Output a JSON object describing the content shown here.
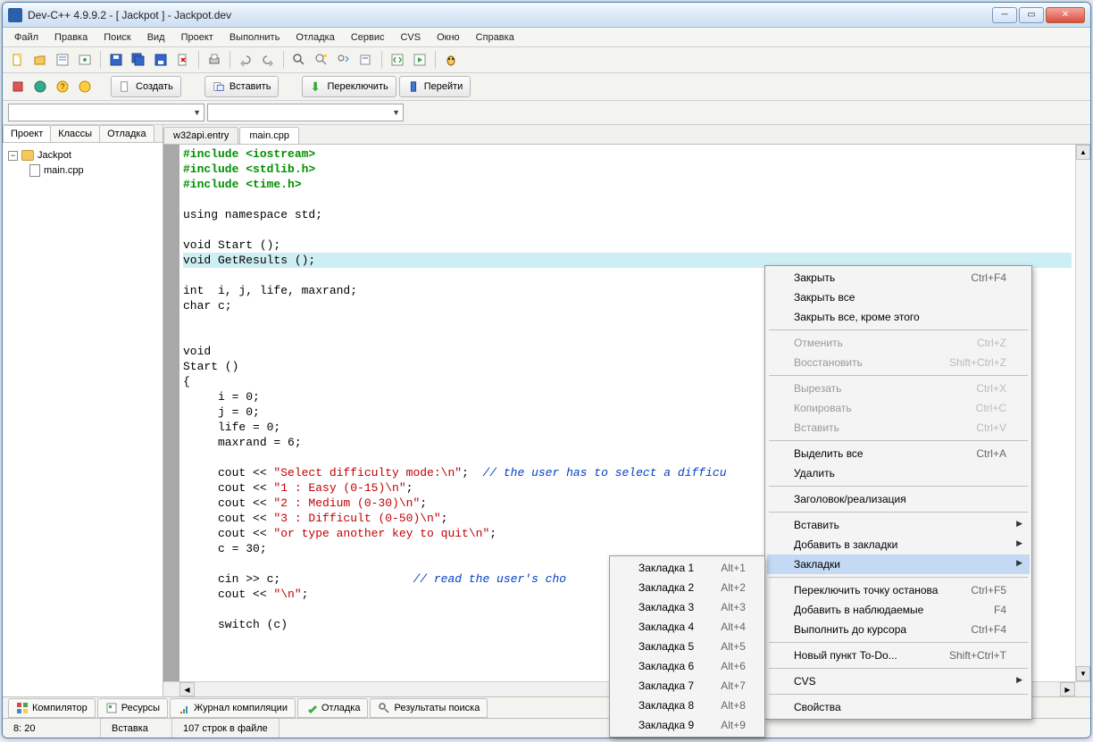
{
  "title": "Dev-C++ 4.9.9.2  -  [ Jackpot ]  -  Jackpot.dev",
  "menu": [
    "Файл",
    "Правка",
    "Поиск",
    "Вид",
    "Проект",
    "Выполнить",
    "Отладка",
    "Сервис",
    "CVS",
    "Окно",
    "Справка"
  ],
  "toolbar2": {
    "create": "Создать",
    "insert": "Вставить",
    "toggle": "Переключить",
    "goto": "Перейти"
  },
  "leftTabs": [
    "Проект",
    "Классы",
    "Отладка"
  ],
  "project": {
    "name": "Jackpot",
    "file": "main.cpp"
  },
  "editorTabs": [
    "w32api.entry",
    "main.cpp"
  ],
  "code": {
    "l1": "#include <iostream>",
    "l2": "#include <stdlib.h>",
    "l3": "#include <time.h>",
    "l5": "using namespace std;",
    "l7": "void Start ();",
    "l8": "void GetResults ();",
    "l10": "int  i, j, life, maxrand;",
    "l11": "char c;",
    "l14": "void",
    "l15": "Start ()",
    "l16": "{",
    "l17": "     i = 0;",
    "l18": "     j = 0;",
    "l19": "     life = 0;",
    "l20": "     maxrand = 6;",
    "l22a": "     cout << ",
    "l22s": "\"Select difficulty mode:\\n\"",
    "l22b": ";  ",
    "l22c": "// the user has to select a difficu",
    "l23a": "     cout << ",
    "l23s": "\"1 : Easy (0-15)\\n\"",
    "l23b": ";",
    "l24a": "     cout << ",
    "l24s": "\"2 : Medium (0-30)\\n\"",
    "l24b": ";",
    "l25a": "     cout << ",
    "l25s": "\"3 : Difficult (0-50)\\n\"",
    "l25b": ";",
    "l26a": "     cout << ",
    "l26s": "\"or type another key to quit\\n\"",
    "l26b": ";",
    "l27": "     c = 30;",
    "l29a": "     cin >> c;",
    "l29c": "                   // read the user's cho",
    "l30a": "     cout << ",
    "l30s": "\"\\n\"",
    "l30b": ";",
    "l32": "     switch (c)"
  },
  "bottomTabs": [
    "Компилятор",
    "Ресурсы",
    "Журнал компиляции",
    "Отладка",
    "Результаты поиска"
  ],
  "status": {
    "pos": "8: 20",
    "mode": "Вставка",
    "lines": "107 строк в файле"
  },
  "ctx": {
    "close": "Закрыть",
    "closeSc": "Ctrl+F4",
    "closeAll": "Закрыть все",
    "closeOthers": "Закрыть все, кроме этого",
    "undo": "Отменить",
    "undoSc": "Ctrl+Z",
    "redo": "Восстановить",
    "redoSc": "Shift+Ctrl+Z",
    "cut": "Вырезать",
    "cutSc": "Ctrl+X",
    "copy": "Копировать",
    "copySc": "Ctrl+C",
    "paste": "Вставить",
    "pasteSc": "Ctrl+V",
    "selectAll": "Выделить все",
    "selectAllSc": "Ctrl+A",
    "delete": "Удалить",
    "headerImpl": "Заголовок/реализация",
    "insert": "Вставить",
    "addBookmark": "Добавить в закладки",
    "bookmarks": "Закладки",
    "toggleBp": "Переключить точку останова",
    "toggleBpSc": "Ctrl+F5",
    "addWatch": "Добавить в наблюдаемые",
    "addWatchSc": "F4",
    "runToCursor": "Выполнить до курсора",
    "runToCursorSc": "Ctrl+F4",
    "newTodo": "Новый пункт To-Do...",
    "newTodoSc": "Shift+Ctrl+T",
    "cvs": "CVS",
    "props": "Свойства"
  },
  "submenu": [
    {
      "label": "Закладка 1",
      "sc": "Alt+1"
    },
    {
      "label": "Закладка 2",
      "sc": "Alt+2"
    },
    {
      "label": "Закладка 3",
      "sc": "Alt+3"
    },
    {
      "label": "Закладка 4",
      "sc": "Alt+4"
    },
    {
      "label": "Закладка 5",
      "sc": "Alt+5"
    },
    {
      "label": "Закладка 6",
      "sc": "Alt+6"
    },
    {
      "label": "Закладка 7",
      "sc": "Alt+7"
    },
    {
      "label": "Закладка 8",
      "sc": "Alt+8"
    },
    {
      "label": "Закладка 9",
      "sc": "Alt+9"
    }
  ]
}
